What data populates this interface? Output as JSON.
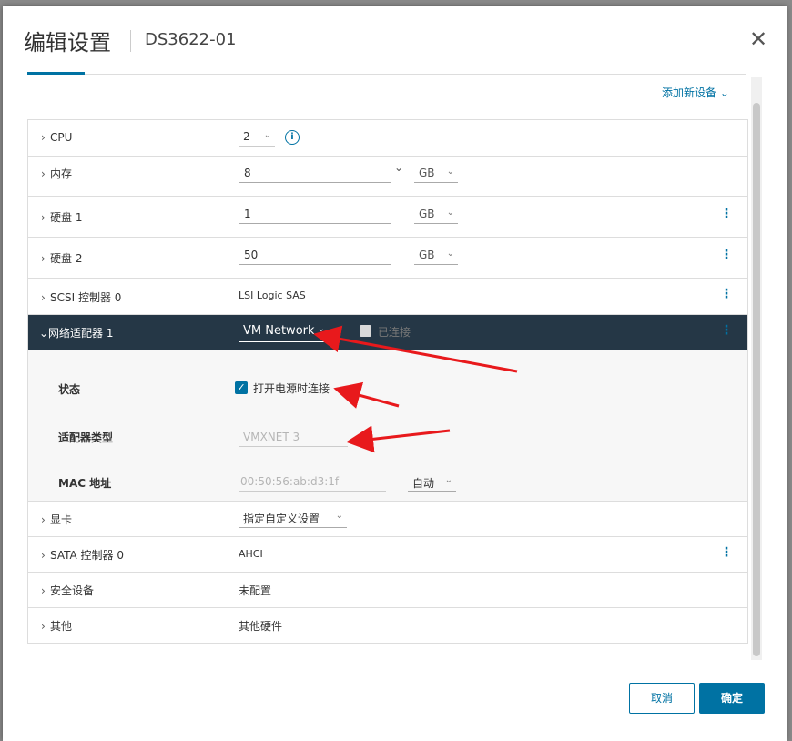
{
  "dialog": {
    "title": "编辑设置",
    "subtitle": "DS3622-01",
    "close_icon": "close-icon",
    "add_device_label": "添加新设备 ⌄",
    "cancel_label": "取消",
    "ok_label": "确定"
  },
  "rows": {
    "cpu": {
      "label": "CPU",
      "value": "2"
    },
    "memory": {
      "label": "内存",
      "value": "8",
      "unit": "GB"
    },
    "disk1": {
      "label": "硬盘 1",
      "value": "1",
      "unit": "GB"
    },
    "disk2": {
      "label": "硬盘 2",
      "value": "50",
      "unit": "GB"
    },
    "scsi": {
      "label": "SCSI 控制器 0",
      "value": "LSI Logic SAS"
    },
    "network": {
      "label": "网络适配器 1",
      "value": "VM Network",
      "connected_label": "已连接",
      "status_label": "状态",
      "power_on_label": "打开电源时连接",
      "power_on_checked": true,
      "adapter_type_label": "适配器类型",
      "adapter_type_value": "VMXNET 3",
      "mac_label": "MAC 地址",
      "mac_value": "00:50:56:ab:d3:1f",
      "mac_mode": "自动"
    },
    "video": {
      "label": "显卡",
      "value": "指定自定义设置"
    },
    "sata": {
      "label": "SATA 控制器 0",
      "value": "AHCI"
    },
    "security": {
      "label": "安全设备",
      "value": "未配置"
    },
    "other": {
      "label": "其他",
      "value": "其他硬件"
    }
  },
  "colors": {
    "accent": "#0072a3",
    "dark_row": "#253746",
    "annotation_arrow": "#e8191c"
  }
}
